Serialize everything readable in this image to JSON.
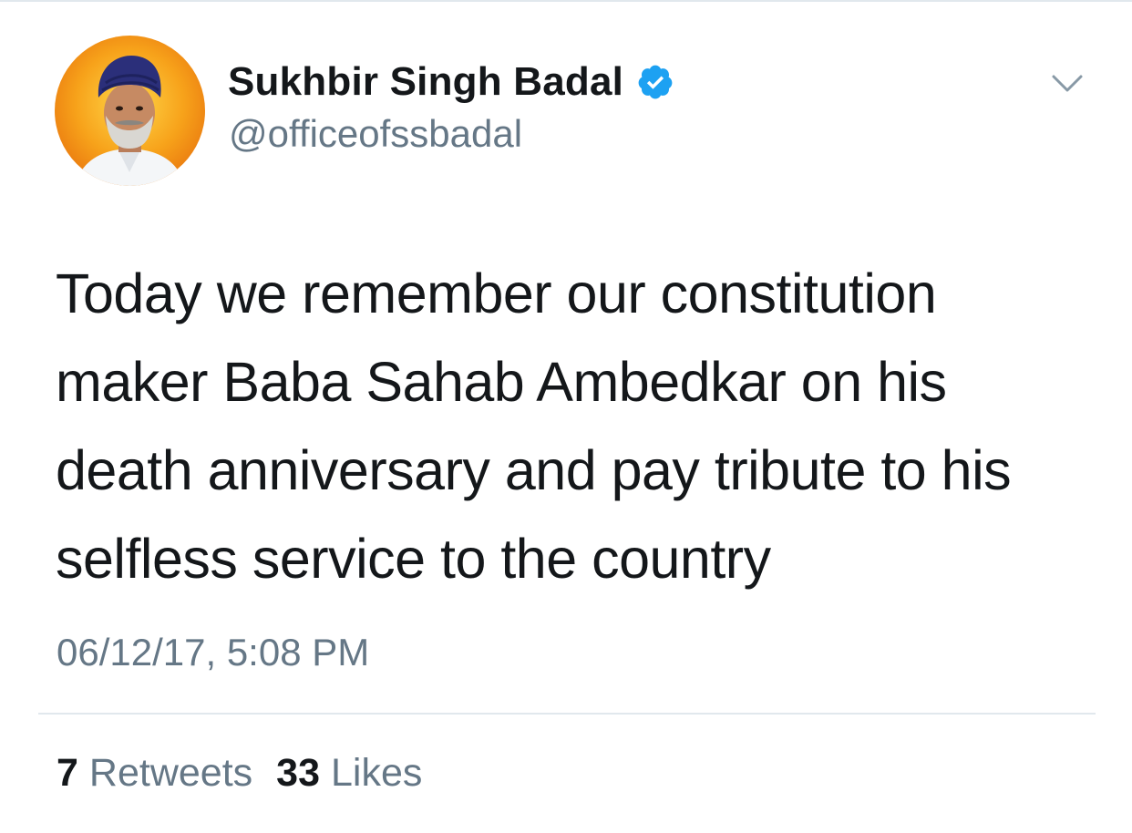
{
  "author": {
    "display_name": "Sukhbir Singh Badal",
    "handle": "@officeofssbadal",
    "verified": true,
    "avatar_icon": "profile-photo"
  },
  "tweet": {
    "text": "Today we remember our constitution\nmaker Baba Sahab Ambedkar on his\ndeath anniversary and pay tribute to his\nselfless service to the country",
    "timestamp": "06/12/17, 5:08 PM"
  },
  "stats": {
    "retweets_count": "7",
    "retweets_label": "Retweets",
    "likes_count": "33",
    "likes_label": "Likes"
  },
  "icons": {
    "verified": "verified-badge-icon",
    "menu": "chevron-down-icon"
  },
  "colors": {
    "text": "#14171a",
    "secondary": "#657786",
    "verified_blue": "#1da1f2",
    "divider": "#e1e8ed"
  }
}
